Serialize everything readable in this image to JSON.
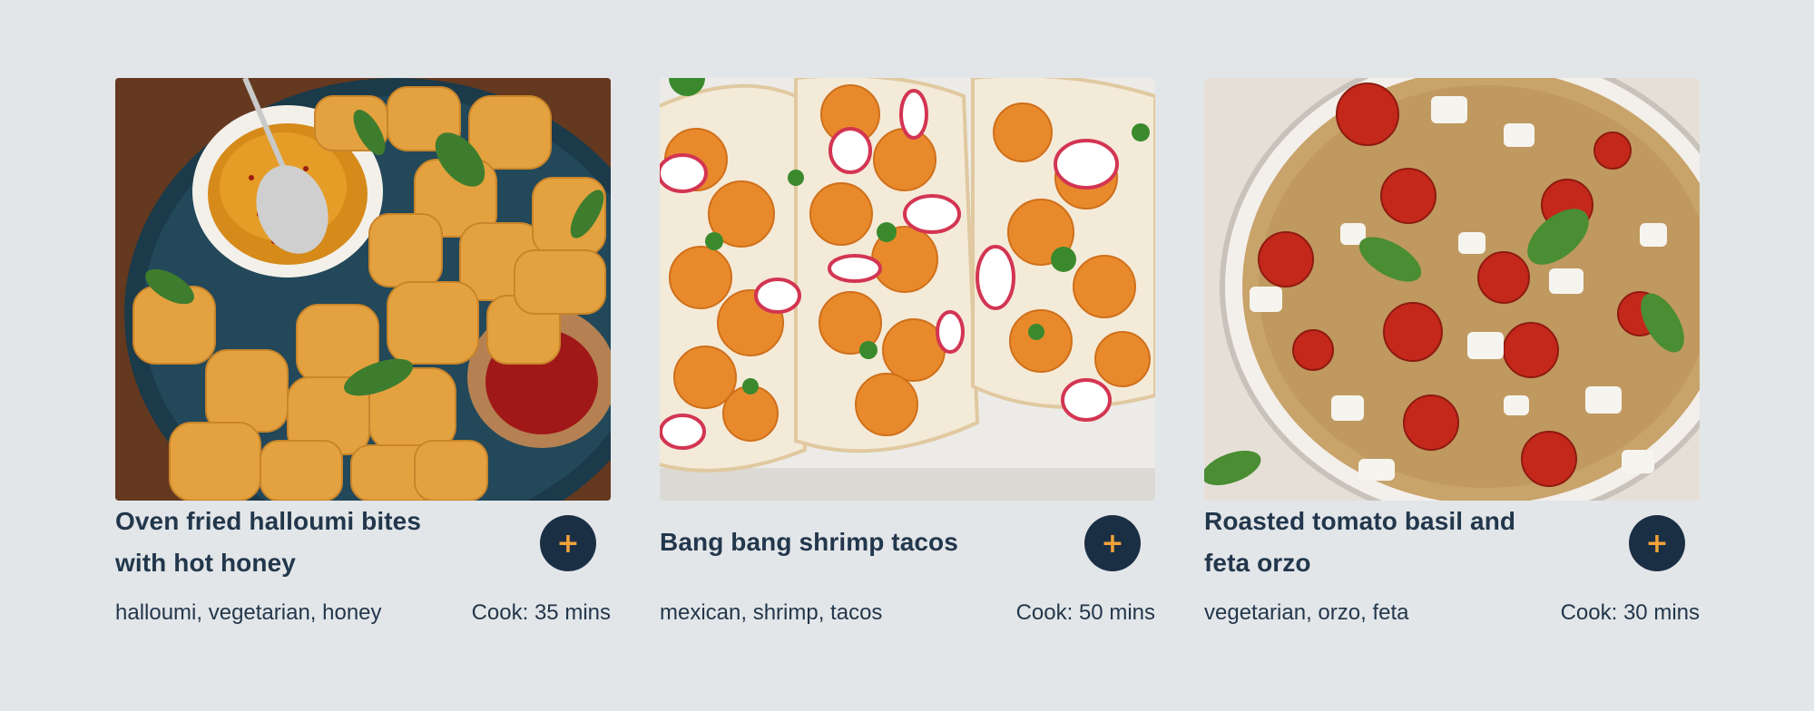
{
  "recipes": [
    {
      "title": "Oven fried halloumi bites with hot honey",
      "tags": "halloumi, vegetarian, honey",
      "cook": "Cook: 35 mins",
      "add_label": "+"
    },
    {
      "title": "Bang bang shrimp tacos",
      "tags": "mexican, shrimp, tacos",
      "cook": "Cook: 50 mins",
      "add_label": "+"
    },
    {
      "title": "Roasted tomato basil and feta orzo",
      "tags": "vegetarian, orzo, feta",
      "cook": "Cook: 30 mins",
      "add_label": "+"
    }
  ],
  "colors": {
    "background": "#e3e6e9",
    "button_bg": "#1b2f44",
    "button_plus": "#f3a33a",
    "text": "#22374c"
  }
}
